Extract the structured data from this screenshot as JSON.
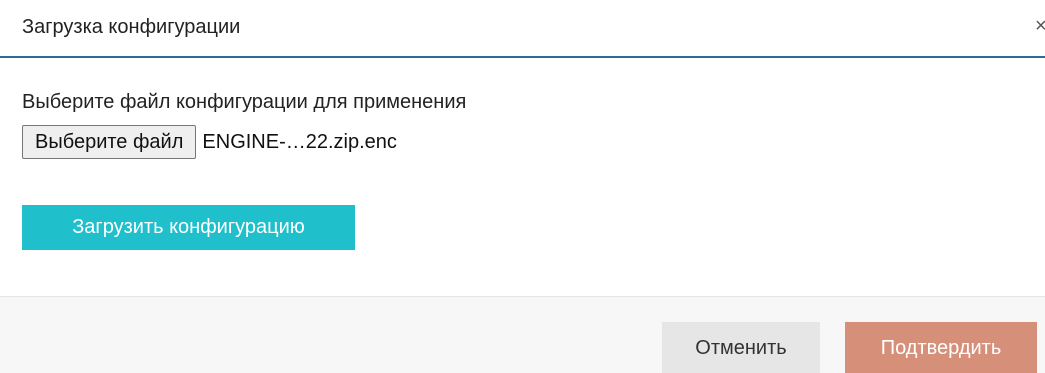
{
  "dialog": {
    "title": "Загрузка конфигурации",
    "close_symbol": "×"
  },
  "body": {
    "prompt": "Выберите файл конфигурации для применения",
    "file_input": {
      "button_label": "Выберите файл",
      "selected_file": "ENGINE-…22.zip.enc"
    },
    "upload_button_label": "Загрузить конфигурацию"
  },
  "footer": {
    "cancel_label": "Отменить",
    "confirm_label": "Подтвердить"
  },
  "icons": {
    "close": "close-icon"
  },
  "colors": {
    "header_underline": "#2c6aa0",
    "upload_button": "#1fbfcb",
    "confirm_button": "#d6907a",
    "cancel_button": "#e6e6e6",
    "footer_background": "#f7f7f7"
  }
}
